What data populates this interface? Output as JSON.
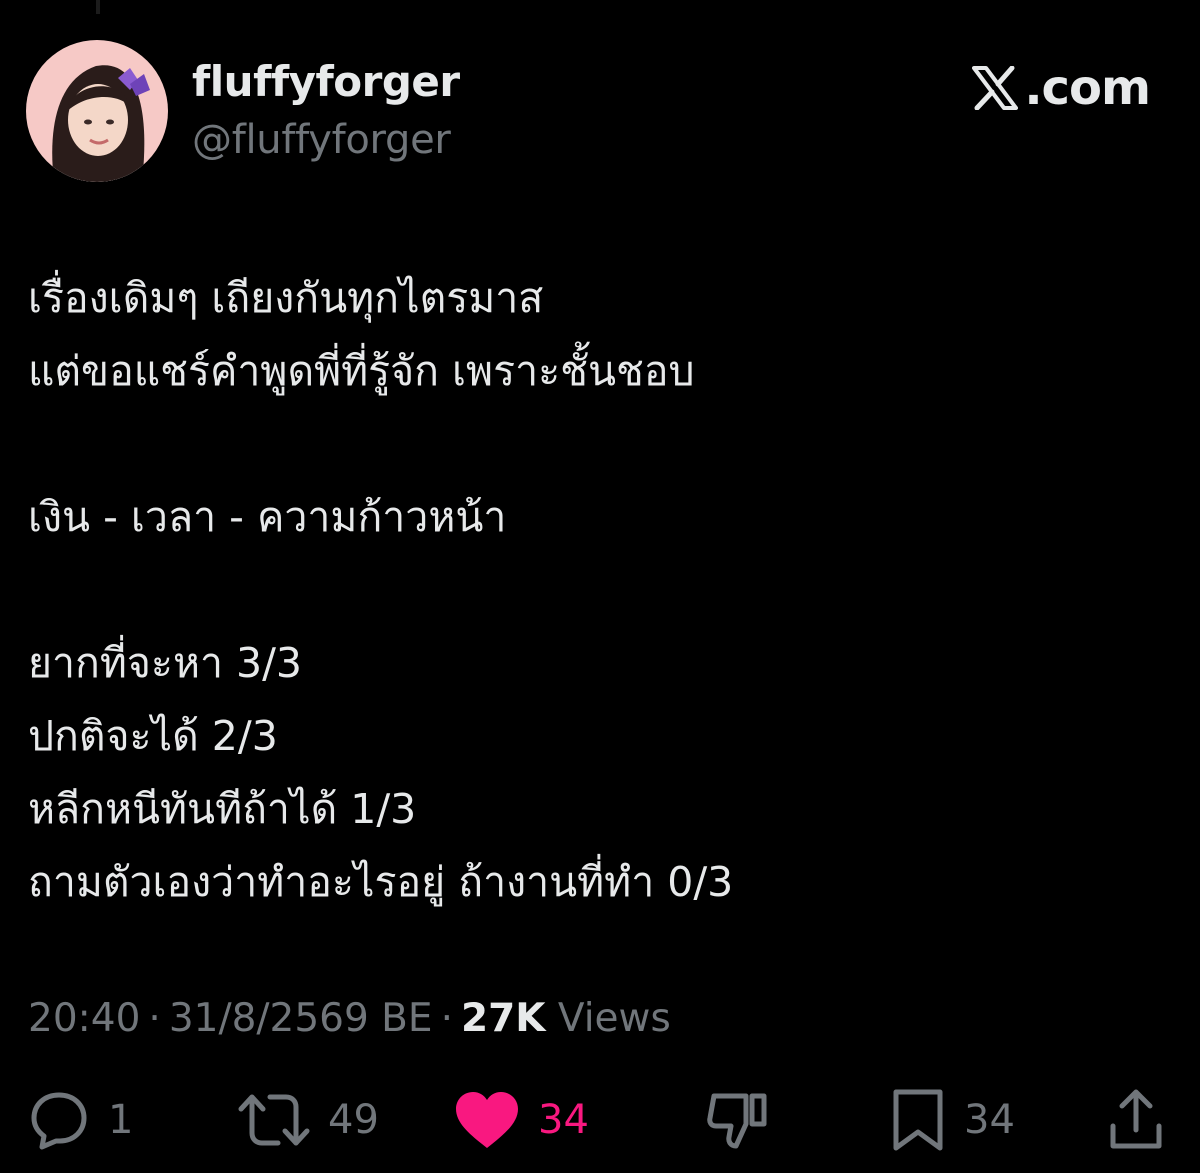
{
  "author": {
    "display_name": "fluffyforger",
    "handle": "@fluffyforger"
  },
  "brand": {
    "text": ".com",
    "icon": "x-logo-icon"
  },
  "tweet": {
    "lines": [
      "เรื่องเดิมๆ เถียงกันทุกไตรมาส",
      "แต่ขอแชร์คำพูดพี่ที่รู้จัก เพราะชั้นชอบ",
      "",
      "เงิน - เวลา - ความก้าวหน้า",
      "",
      "ยากที่จะหา 3/3",
      "ปกติจะได้ 2/3",
      "หลีกหนีทันทีถ้าได้ 1/3",
      "ถามตัวเองว่าทำอะไรอยู่ ถ้างานที่ทำ 0/3"
    ]
  },
  "meta": {
    "time": "20:40",
    "date": "31/8/2569 BE",
    "separator": "·",
    "views_count": "27K",
    "views_label": "Views"
  },
  "actions": {
    "reply": {
      "icon": "reply-icon",
      "count": "1"
    },
    "repost": {
      "icon": "repost-icon",
      "count": "49"
    },
    "like": {
      "icon": "heart-icon",
      "count": "34",
      "active_color": "#f91880"
    },
    "dislike": {
      "icon": "dislike-icon"
    },
    "bookmark": {
      "icon": "bookmark-icon",
      "count": "34"
    },
    "share": {
      "icon": "share-icon"
    }
  },
  "colors": {
    "background": "#000000",
    "text_primary": "#e7e9ea",
    "text_secondary": "#71767b",
    "like": "#f91880"
  }
}
